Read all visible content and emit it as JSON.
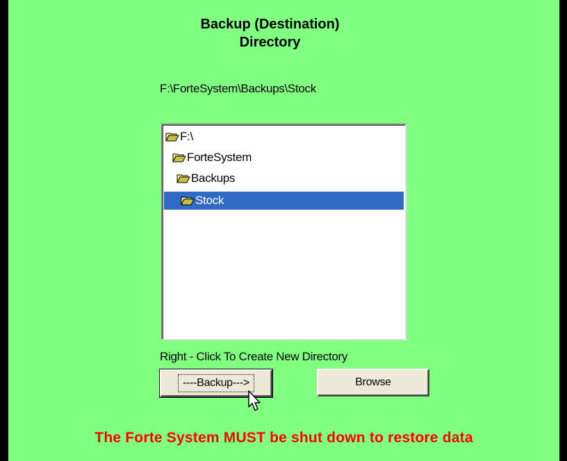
{
  "dialog": {
    "title_line1": "Backup (Destination)",
    "title_line2": "Directory",
    "current_path": "F:\\ForteSystem\\Backups\\Stock",
    "tree": [
      {
        "label": "F:\\",
        "selected": false,
        "icon": "open-folder-icon"
      },
      {
        "label": "ForteSystem",
        "selected": false,
        "icon": "open-folder-icon"
      },
      {
        "label": "Backups",
        "selected": false,
        "icon": "open-folder-icon"
      },
      {
        "label": "Stock",
        "selected": true,
        "icon": "open-folder-icon"
      }
    ],
    "hint": "Right - Click To Create New Directory",
    "backup_label": "----Backup--->",
    "browse_label": "Browse",
    "warning": "The Forte System MUST be shut down to restore data"
  },
  "colors": {
    "panel_background": "#80ff80",
    "selection": "#316ac5",
    "warning_text": "#ff0000",
    "button_face": "#ece9d8"
  }
}
